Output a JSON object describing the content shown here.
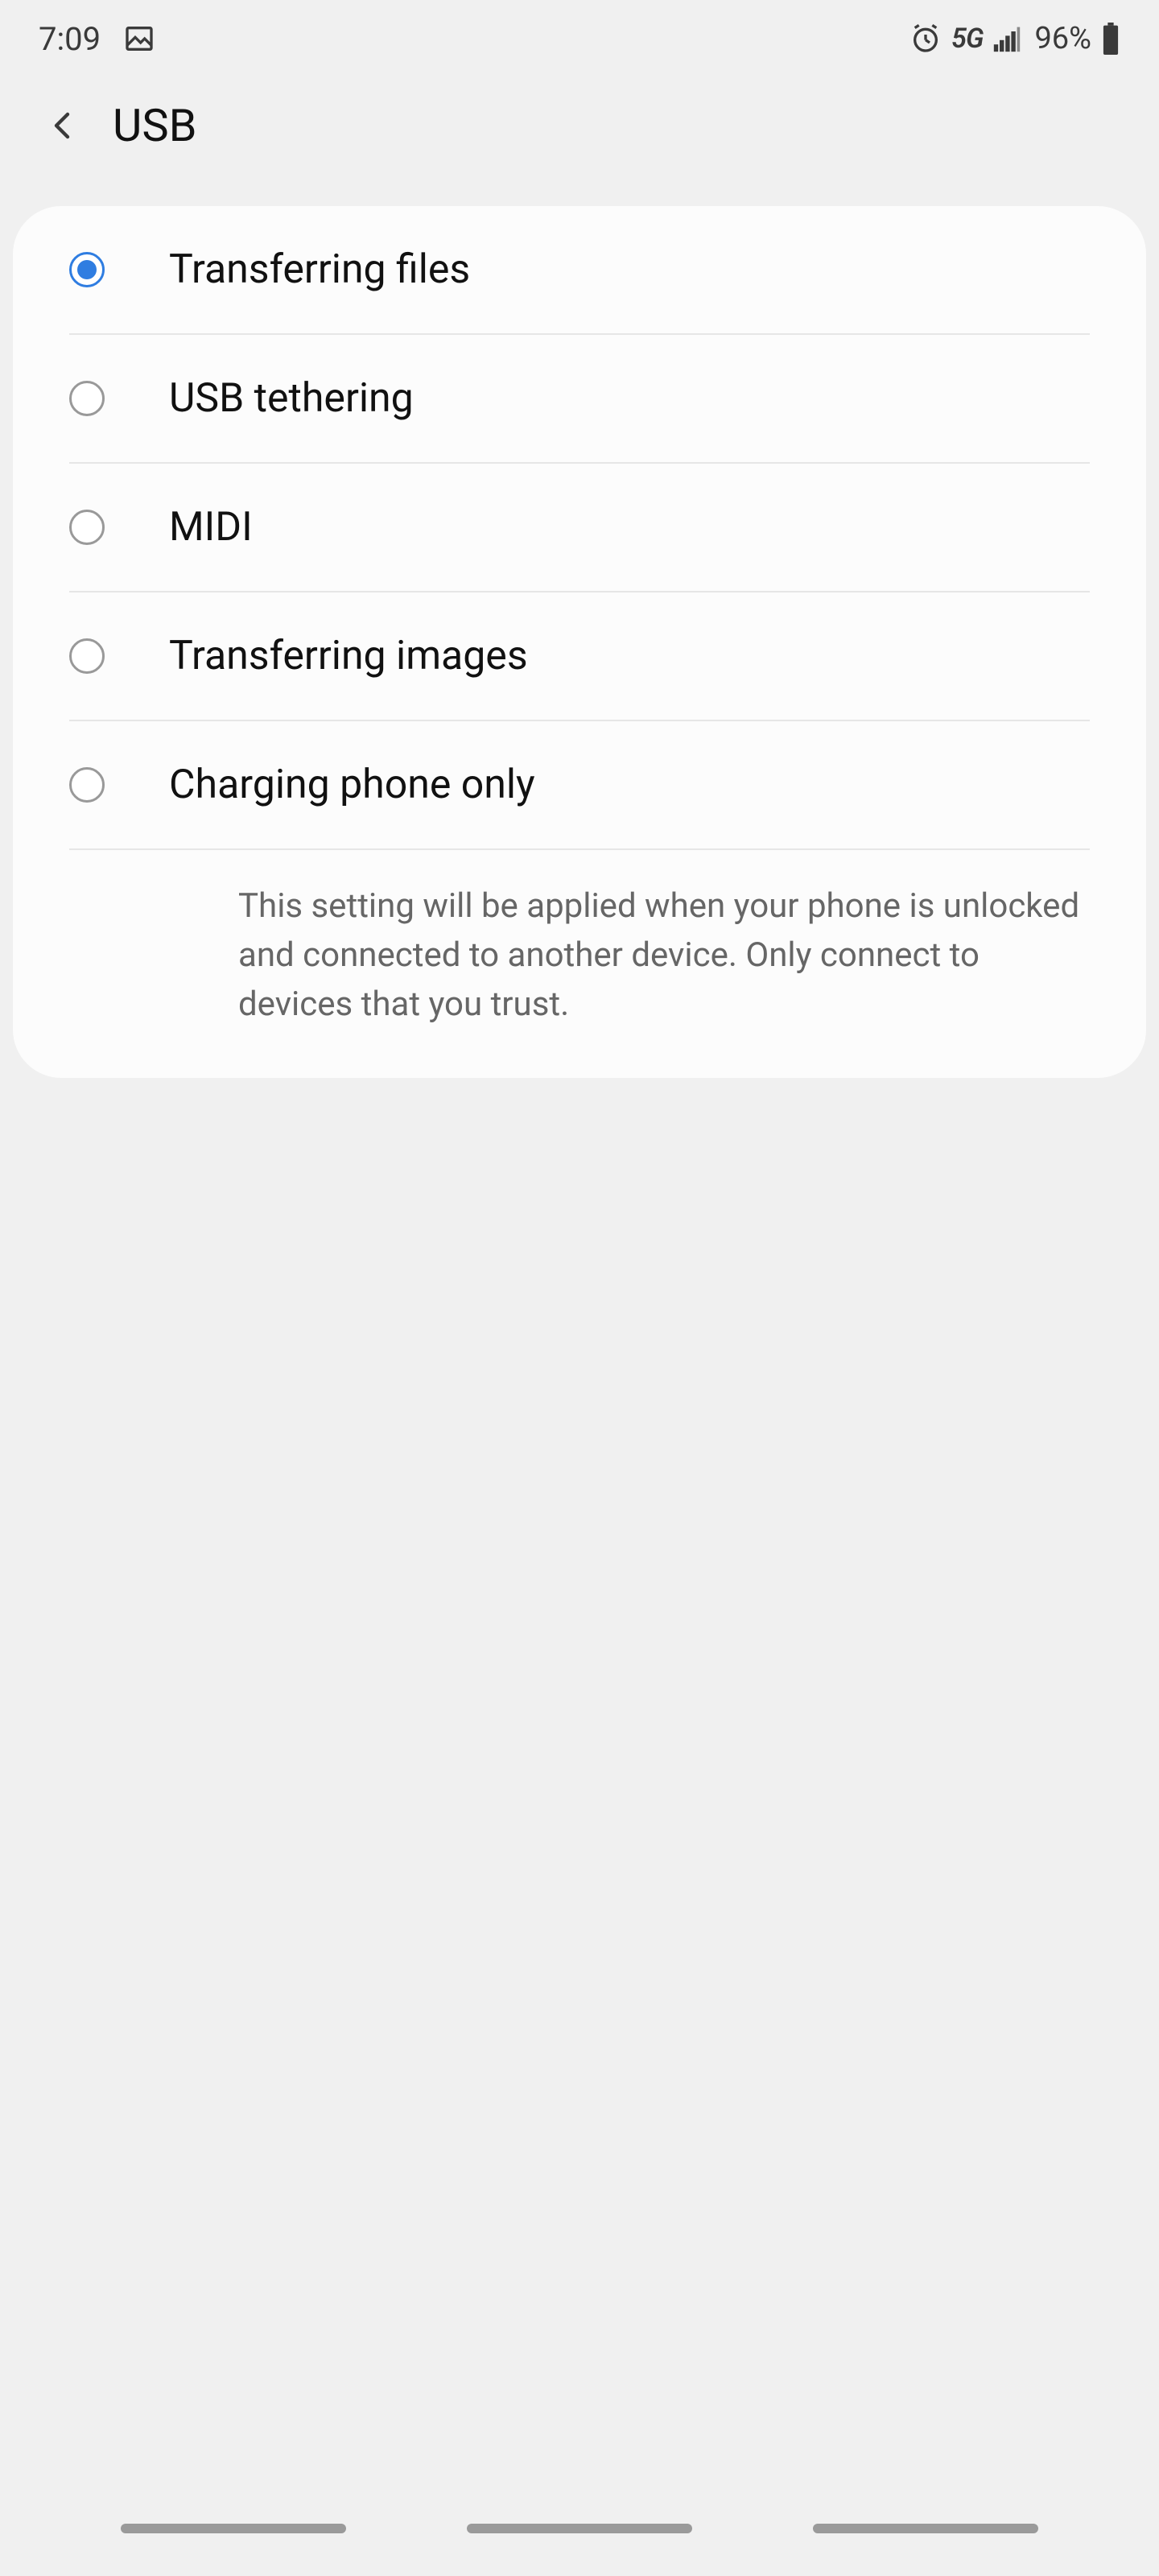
{
  "status": {
    "time": "7:09",
    "network": "5G",
    "battery_pct": "96%"
  },
  "header": {
    "title": "USB"
  },
  "options": [
    {
      "label": "Transferring files",
      "selected": true
    },
    {
      "label": "USB tethering",
      "selected": false
    },
    {
      "label": "MIDI",
      "selected": false
    },
    {
      "label": "Transferring images",
      "selected": false
    },
    {
      "label": "Charging phone only",
      "selected": false
    }
  ],
  "helper_text": "This setting will be applied when your phone is unlocked and connected to another device. Only connect to devices that you trust."
}
